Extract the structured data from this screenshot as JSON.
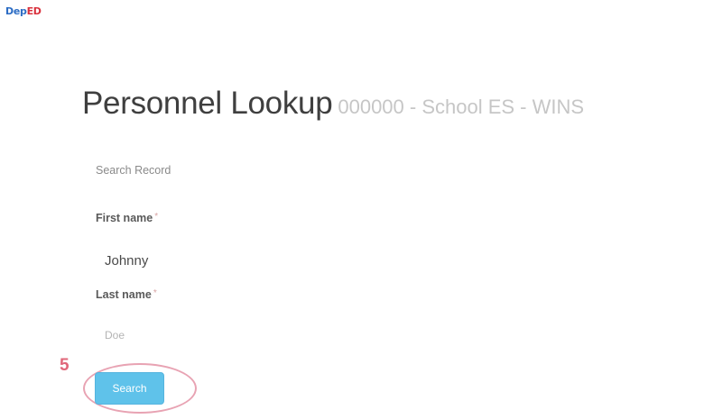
{
  "brand": {
    "logo_dep": "Dep",
    "logo_ed": "ED"
  },
  "header": {
    "title": "Personnel Lookup",
    "subtitle": "000000 - School ES - WINS"
  },
  "form": {
    "section_label": "Search Record",
    "first_name": {
      "label": "First name",
      "required_mark": "*",
      "value": "Johnny"
    },
    "last_name": {
      "label": "Last name",
      "required_mark": "*",
      "value": "Doe"
    },
    "search_button_label": "Search"
  },
  "annotation": {
    "step_number": "5",
    "highlight_color": "#e8a3b3"
  },
  "colors": {
    "button": "#5fc2ea",
    "title": "#3f3f3f",
    "subtitle": "#c6c6c6"
  }
}
